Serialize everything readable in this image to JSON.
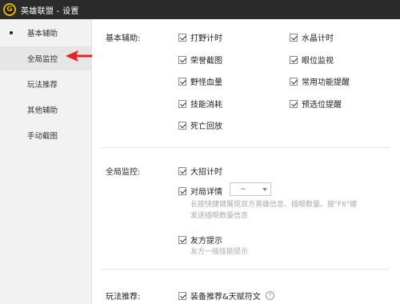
{
  "window": {
    "title": "英雄联盟 - 设置",
    "logo_letter": "G"
  },
  "sidebar": {
    "items": [
      {
        "label": "基本辅助",
        "active": true
      },
      {
        "label": "全局监控"
      },
      {
        "label": "玩法推荐"
      },
      {
        "label": "其他辅助"
      },
      {
        "label": "手动截图"
      }
    ]
  },
  "basic": {
    "label": "基本辅助:",
    "options": [
      "打野计时",
      "水晶计时",
      "荣誉截图",
      "眼位监视",
      "野怪血量",
      "常用功能提醒",
      "技能消耗",
      "预选位提醒",
      "死亡回放"
    ]
  },
  "monitor": {
    "label": "全局监控:",
    "opt1": "大招计时",
    "opt2": "对局详情",
    "select_value": "~",
    "desc2_line1": "长按快捷键展现双方英雄信息、插眼数量。按\"F6\"键",
    "desc2_line2": "发送插眼数量信息",
    "opt3": "友方提示",
    "desc3": "友方一级技能提示"
  },
  "gameplay": {
    "label": "玩法推荐:",
    "opt1": "装备推荐&天赋符文",
    "help": "?"
  },
  "colors": {
    "titlebar": "#2b2b2b",
    "accent_logo": "#e9b300",
    "arrow": "#e8202a"
  }
}
